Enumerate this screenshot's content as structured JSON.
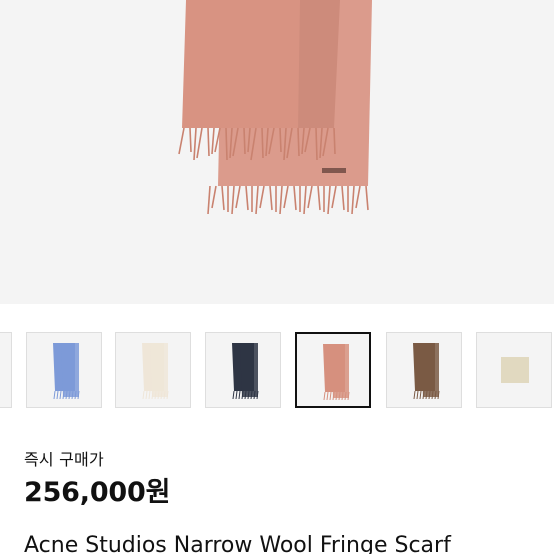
{
  "hero_image": {
    "icon": "scarf-image",
    "scarf_color": "#d89382",
    "fringe_color": "#c9826f"
  },
  "thumbnails": [
    {
      "name": "thumb-partial",
      "scarf_color": "#eeeeee",
      "selected": false
    },
    {
      "name": "thumb-blue",
      "scarf_color": "#7d9ad8",
      "selected": false
    },
    {
      "name": "thumb-cream",
      "scarf_color": "#efe6d8",
      "selected": false
    },
    {
      "name": "thumb-navy",
      "scarf_color": "#2e3544",
      "selected": false
    },
    {
      "name": "thumb-pink",
      "scarf_color": "#d6907e",
      "selected": true
    },
    {
      "name": "thumb-brown",
      "scarf_color": "#7a5a44",
      "selected": false
    },
    {
      "name": "thumb-beige",
      "scarf_color": "#e1d9c0",
      "selected": false
    }
  ],
  "price": {
    "label": "즉시 구매가",
    "value": "256,000원"
  },
  "product": {
    "title": "Acne Studios Narrow Wool Fringe Scarf"
  }
}
